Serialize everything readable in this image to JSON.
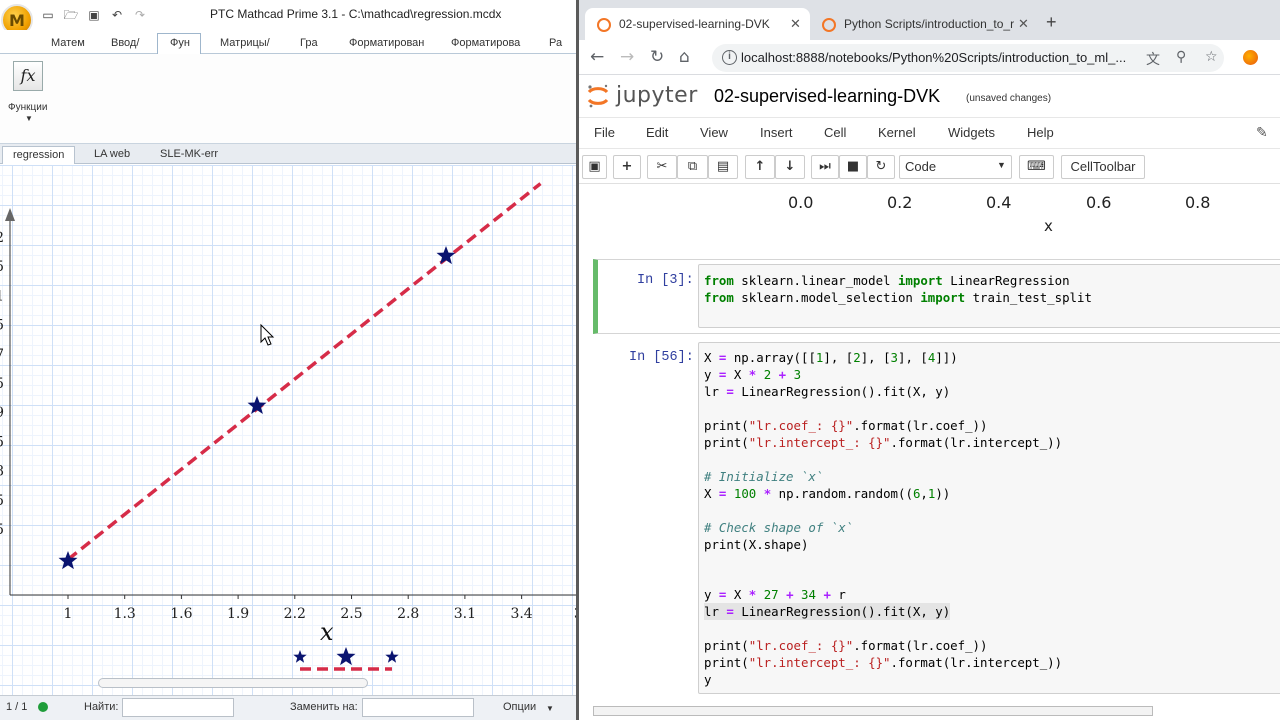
{
  "mathcad": {
    "title": "PTC Mathcad Prime 3.1 - C:\\mathcad\\regression.mcdx",
    "logo_letter": "M",
    "quick_access": [
      "open-folder-icon",
      "save-icon",
      "undo-icon",
      "redo-icon"
    ],
    "ribbon_tabs": [
      "Матем",
      "Ввод/",
      "Фун",
      "Матрицы/",
      "Гра",
      "Форматирован",
      "Форматирова",
      "Ра"
    ],
    "active_ribbon_tab": "Фун",
    "function_button": {
      "icon_text": "fx",
      "label": "Функции"
    },
    "doc_tabs": [
      "regression",
      "LA web",
      "SLE-MK-err"
    ],
    "active_doc_tab": "regression",
    "plot": {
      "x_ticks": [
        "1",
        "1.3",
        "1.6",
        "1.9",
        "2.2",
        "2.5",
        "2.8",
        "3.1",
        "3.4",
        "3"
      ],
      "y_ticks": [
        "2",
        "5",
        "1",
        "5",
        "7",
        "5",
        "9",
        "5",
        "8",
        "5",
        "5"
      ],
      "x_axis_label": "x",
      "accent_colors": {
        "points": "#0a1470",
        "line": "#d62c48"
      }
    },
    "status": {
      "page": "1 / 1",
      "find_label": "Найти:",
      "find_value": "",
      "replace_label": "Заменить на:",
      "replace_value": "",
      "options_label": "Опции"
    }
  },
  "chart_data": {
    "type": "scatter",
    "title": "",
    "xlabel": "x",
    "ylabel": "",
    "series": [
      {
        "kind": "points",
        "x": [
          1,
          2,
          3
        ],
        "y": [
          5,
          8,
          10.9
        ]
      },
      {
        "kind": "fit-line",
        "x": [
          1,
          3.5
        ],
        "y": [
          5.03,
          12.3
        ]
      }
    ],
    "legend_glyphs": [
      "star",
      "dashed-line"
    ]
  },
  "browser": {
    "tabs": [
      {
        "title": "02-supervised-learning-DVK",
        "active": true
      },
      {
        "title": "Python Scripts/introduction_to_r",
        "active": false
      }
    ],
    "url": "localhost:8888/notebooks/Python%20Scripts/introduction_to_ml_..."
  },
  "jupyter": {
    "brand": "jupyter",
    "notebook_title": "02-supervised-learning-DVK",
    "status": "(unsaved changes)",
    "menu": [
      "File",
      "Edit",
      "View",
      "Insert",
      "Cell",
      "Kernel",
      "Widgets",
      "Help"
    ],
    "cell_type": "Code",
    "cell_toolbar": "CellToolbar",
    "prev_output": {
      "x_ticks": [
        "0.0",
        "0.2",
        "0.4",
        "0.6",
        "0.8"
      ],
      "x_label": "x"
    },
    "cells": [
      {
        "prompt": "In [3]:",
        "lines": [
          "from sklearn.linear_model import LinearRegression",
          "from sklearn.model_selection import train_test_split"
        ]
      },
      {
        "prompt": "In [56]:",
        "lines": [
          "X = np.array([[1], [2], [3], [4]])",
          "y = X * 2 + 3",
          "lr = LinearRegression().fit(X, y)",
          "",
          "print(\"lr.coef_: {}\".format(lr.coef_))",
          "print(\"lr.intercept_: {}\".format(lr.intercept_))",
          "",
          "# Initialize `x`",
          "X = 100 * np.random.random((6,1))",
          "",
          "# Check shape of `x`",
          "print(X.shape)",
          "",
          "",
          "y = X * 27 + 34 + r",
          "lr = LinearRegression().fit(X, y)",
          "",
          "print(\"lr.coef_: {}\".format(lr.coef_))",
          "print(\"lr.intercept_: {}\".format(lr.intercept_))",
          "y"
        ]
      }
    ]
  }
}
